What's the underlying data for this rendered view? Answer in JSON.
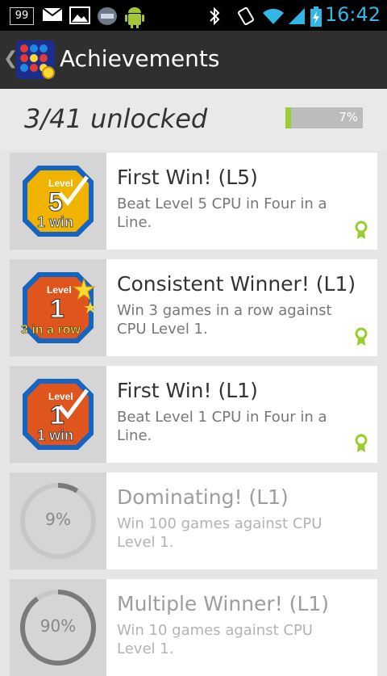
{
  "status_bar": {
    "notification_count": "99",
    "time": "16:42",
    "icons": [
      "mail-icon",
      "image-icon",
      "sd-card-icon",
      "android-icon",
      "bluetooth-icon",
      "vibrate-icon",
      "wifi-icon",
      "signal-icon",
      "battery-charging-icon"
    ]
  },
  "action_bar": {
    "title": "Achievements",
    "logo_icon": "four-in-a-line-logo-icon"
  },
  "summary": {
    "unlocked_text": "3/41 unlocked",
    "progress_label": "7%",
    "progress_fraction": 0.07
  },
  "achievements": [
    {
      "title": "First Win! (L5)",
      "desc": "Beat Level 5 CPU in Four in a Line.",
      "status": "unlocked",
      "badge": {
        "top": "Level",
        "num": "5",
        "bottom": "1 win",
        "color": "#f0b400"
      }
    },
    {
      "title": "Consistent Winner! (L1)",
      "desc": "Win 3 games in a row against CPU Level 1.",
      "status": "unlocked",
      "badge": {
        "top": "Level",
        "num": "1",
        "bottom": "3 in a row",
        "color": "#e0551e"
      }
    },
    {
      "title": "First Win! (L1)",
      "desc": "Beat Level 1 CPU in Four in a Line.",
      "status": "unlocked",
      "badge": {
        "top": "Level",
        "num": "1",
        "bottom": "1 win",
        "color": "#e0551e"
      }
    },
    {
      "title": "Dominating! (L1)",
      "desc": "Win 100 games against CPU Level 1.",
      "status": "locked",
      "progress": "9%",
      "progress_fraction": 0.09
    },
    {
      "title": "Multiple Winner! (L1)",
      "desc": "Win 10 games against CPU Level 1.",
      "status": "locked",
      "progress": "90%",
      "progress_fraction": 0.9
    }
  ],
  "colors": {
    "accent": "#9acd32",
    "time": "#33b5e5",
    "actionbar": "#2f2f2f"
  }
}
